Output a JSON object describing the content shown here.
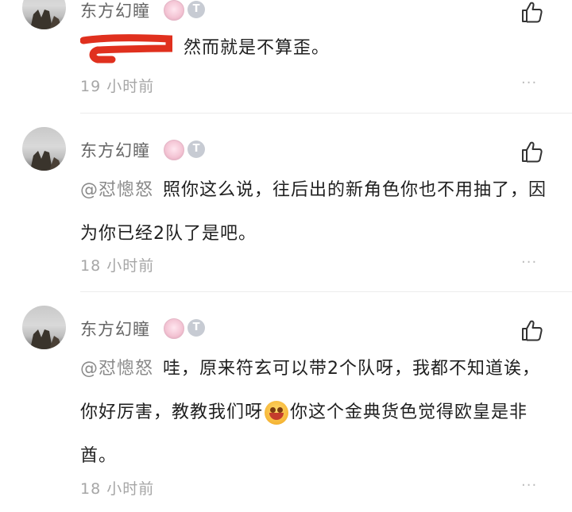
{
  "comments": [
    {
      "username": "东方幻瞳",
      "mention": "",
      "text": "然而就是不算歪。",
      "time": "19 小时前"
    },
    {
      "username": "东方幻瞳",
      "mention": "@怼憁怒",
      "text": "照你这么说，往后出的新角色你也不用抽了，因为你已经2队了是吧。",
      "time": "18 小时前"
    },
    {
      "username": "东方幻瞳",
      "mention": "@怼憁怒",
      "text_before": "哇，原来符玄可以带2个队呀，我都不知道诶，你好厉害，教教我们呀",
      "text_after": "你这个金典货色觉得欧皇是非酋。",
      "time": "18 小时前"
    }
  ],
  "icons": {
    "like": "thumbs-up-icon",
    "more": "more-dots-icon",
    "badge": "avatar-badge-icon",
    "level": "level-t-icon",
    "emoji": "grinning-emoji-icon"
  },
  "more_symbol": "···",
  "level_letter": "T",
  "redaction_color": "#e0301e"
}
